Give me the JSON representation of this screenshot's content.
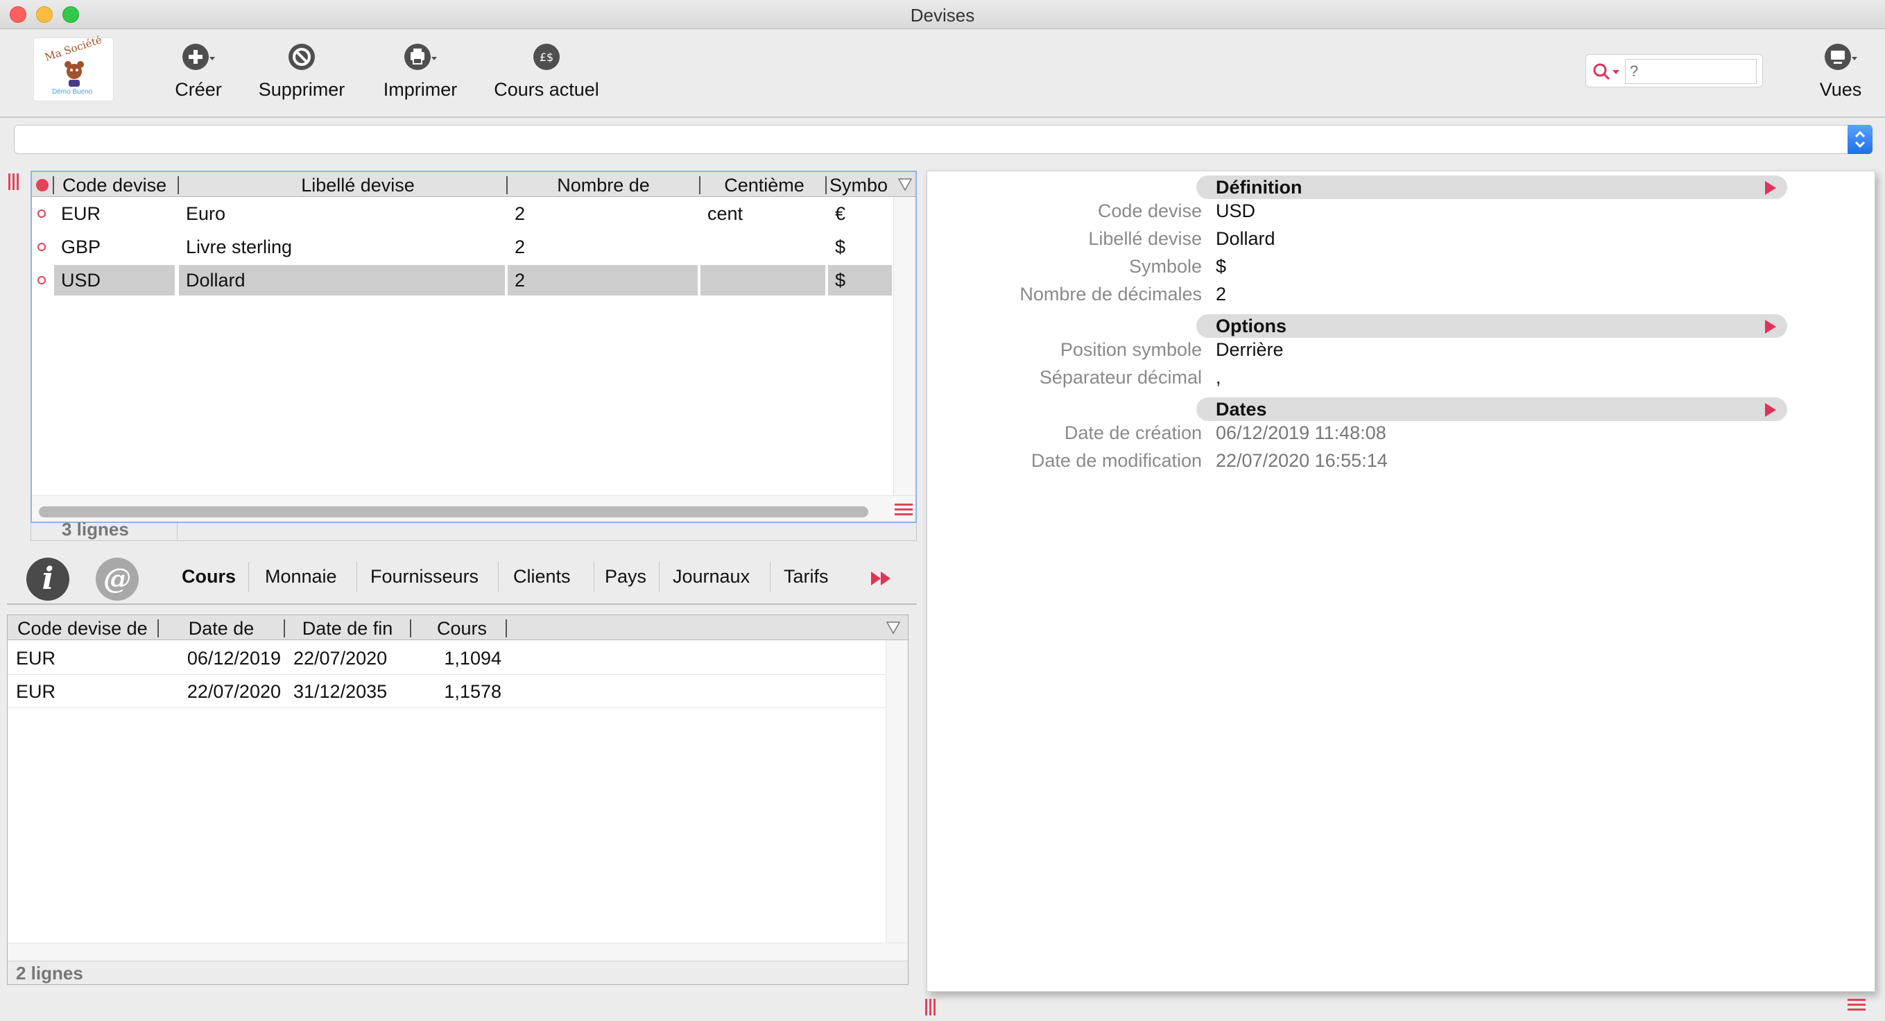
{
  "window": {
    "title": "Devises"
  },
  "toolbar": {
    "logo_text": "Ma Société",
    "logo_subtext": "Démo Bueno",
    "create": "Créer",
    "delete": "Supprimer",
    "print": "Imprimer",
    "current_rate": "Cours actuel",
    "search_placeholder": "?",
    "views": "Vues"
  },
  "currency_grid": {
    "columns": [
      "Code devise",
      "Libellé devise",
      "Nombre de",
      "Centième",
      "Symbo"
    ],
    "rows": [
      {
        "code": "EUR",
        "label": "Euro",
        "decimals": "2",
        "cents": "cent",
        "symbol": "€"
      },
      {
        "code": "GBP",
        "label": "Livre sterling",
        "decimals": "2",
        "cents": "",
        "symbol": "$"
      },
      {
        "code": "USD",
        "label": "Dollard",
        "decimals": "2",
        "cents": "",
        "symbol": "$"
      }
    ],
    "selected_index": 2,
    "footer": "3 lignes"
  },
  "tabs": {
    "info_letter": "i",
    "at_letter": "@",
    "items": [
      "Cours",
      "Monnaie",
      "Fournisseurs",
      "Clients",
      "Pays",
      "Journaux",
      "Tarifs"
    ],
    "active_index": 0
  },
  "rates_grid": {
    "columns": [
      "Code devise de",
      "Date de",
      "Date de fin",
      "Cours"
    ],
    "rows": [
      {
        "code": "EUR",
        "start": "06/12/2019",
        "end": "22/07/2020",
        "rate": "1,1094"
      },
      {
        "code": "EUR",
        "start": "22/07/2020",
        "end": "31/12/2035",
        "rate": "1,1578"
      }
    ],
    "footer": "2 lignes"
  },
  "detail": {
    "sections": {
      "definition": "Définition",
      "options": "Options",
      "dates": "Dates"
    },
    "fields": {
      "code_label": "Code devise",
      "code_value": "USD",
      "label_label": "Libellé devise",
      "label_value": "Dollard",
      "symbol_label": "Symbole",
      "symbol_value": "$",
      "decimals_label": "Nombre de décimales",
      "decimals_value": "2",
      "position_label": "Position symbole",
      "position_value": "Derrière",
      "separator_label": "Séparateur décimal",
      "separator_value": ",",
      "created_label": "Date de création",
      "created_value": "06/12/2019 11:48:08",
      "modified_label": "Date de modification",
      "modified_value": "22/07/2020 16:55:14"
    }
  },
  "colors": {
    "accent_red": "#e0335a",
    "selection_blue": "#8fb3e6",
    "row_selected": "#cdcdcd"
  }
}
